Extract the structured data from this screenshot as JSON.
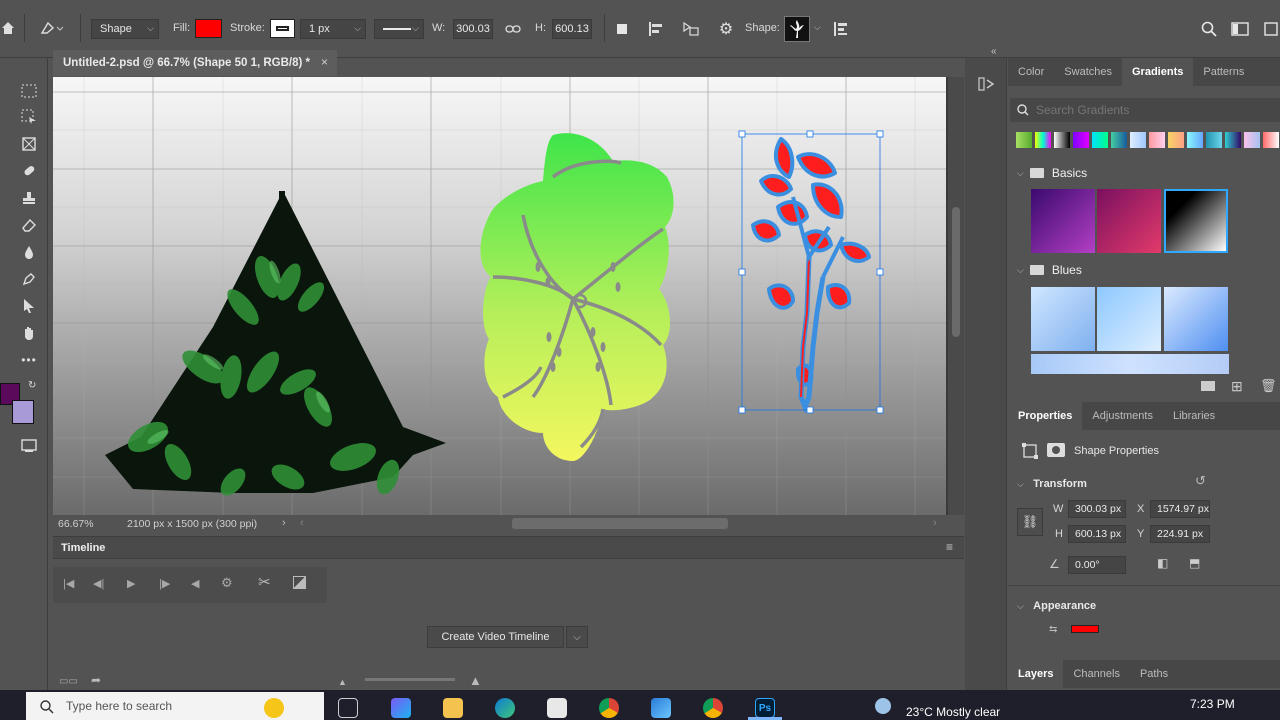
{
  "options_bar": {
    "mode": "Shape",
    "fill_label": "Fill:",
    "stroke_label": "Stroke:",
    "stroke_width": "1 px",
    "w_label": "W:",
    "w_value": "300.03",
    "h_label": "H:",
    "h_value": "600.13",
    "shape_label": "Shape:",
    "fill_color": "#ff0000"
  },
  "document": {
    "tab_title": "Untitled-2.psd @ 66.7% (Shape 50 1, RGB/8) *",
    "zoom": "66.67%",
    "dimensions": "2100 px x 1500 px (300 ppi)"
  },
  "colors": {
    "foreground": "#5b0a5b",
    "background": "#a89ad6",
    "accent": "#31a8ff"
  },
  "timeline": {
    "title": "Timeline",
    "create_button": "Create Video Timeline"
  },
  "color_panel": {
    "tabs": [
      "Color",
      "Swatches",
      "Gradients",
      "Patterns"
    ],
    "active_tab": "Gradients",
    "search_placeholder": "Search Gradients",
    "groups": [
      "Basics",
      "Blues"
    ]
  },
  "properties_panel": {
    "tabs": [
      "Properties",
      "Adjustments",
      "Libraries"
    ],
    "active_tab": "Properties",
    "subtitle": "Shape Properties",
    "transform_title": "Transform",
    "w_label": "W",
    "w": "300.03 px",
    "h_label": "H",
    "h": "600.13 px",
    "x_label": "X",
    "x": "1574.97 px",
    "y_label": "Y",
    "y": "224.91 px",
    "angle": "0.00°",
    "appearance_title": "Appearance"
  },
  "layers_panel": {
    "tabs": [
      "Layers",
      "Channels",
      "Paths"
    ]
  },
  "taskbar": {
    "search_placeholder": "Type here to search",
    "weather": "23°C  Mostly clear",
    "time": "7:23 PM"
  }
}
